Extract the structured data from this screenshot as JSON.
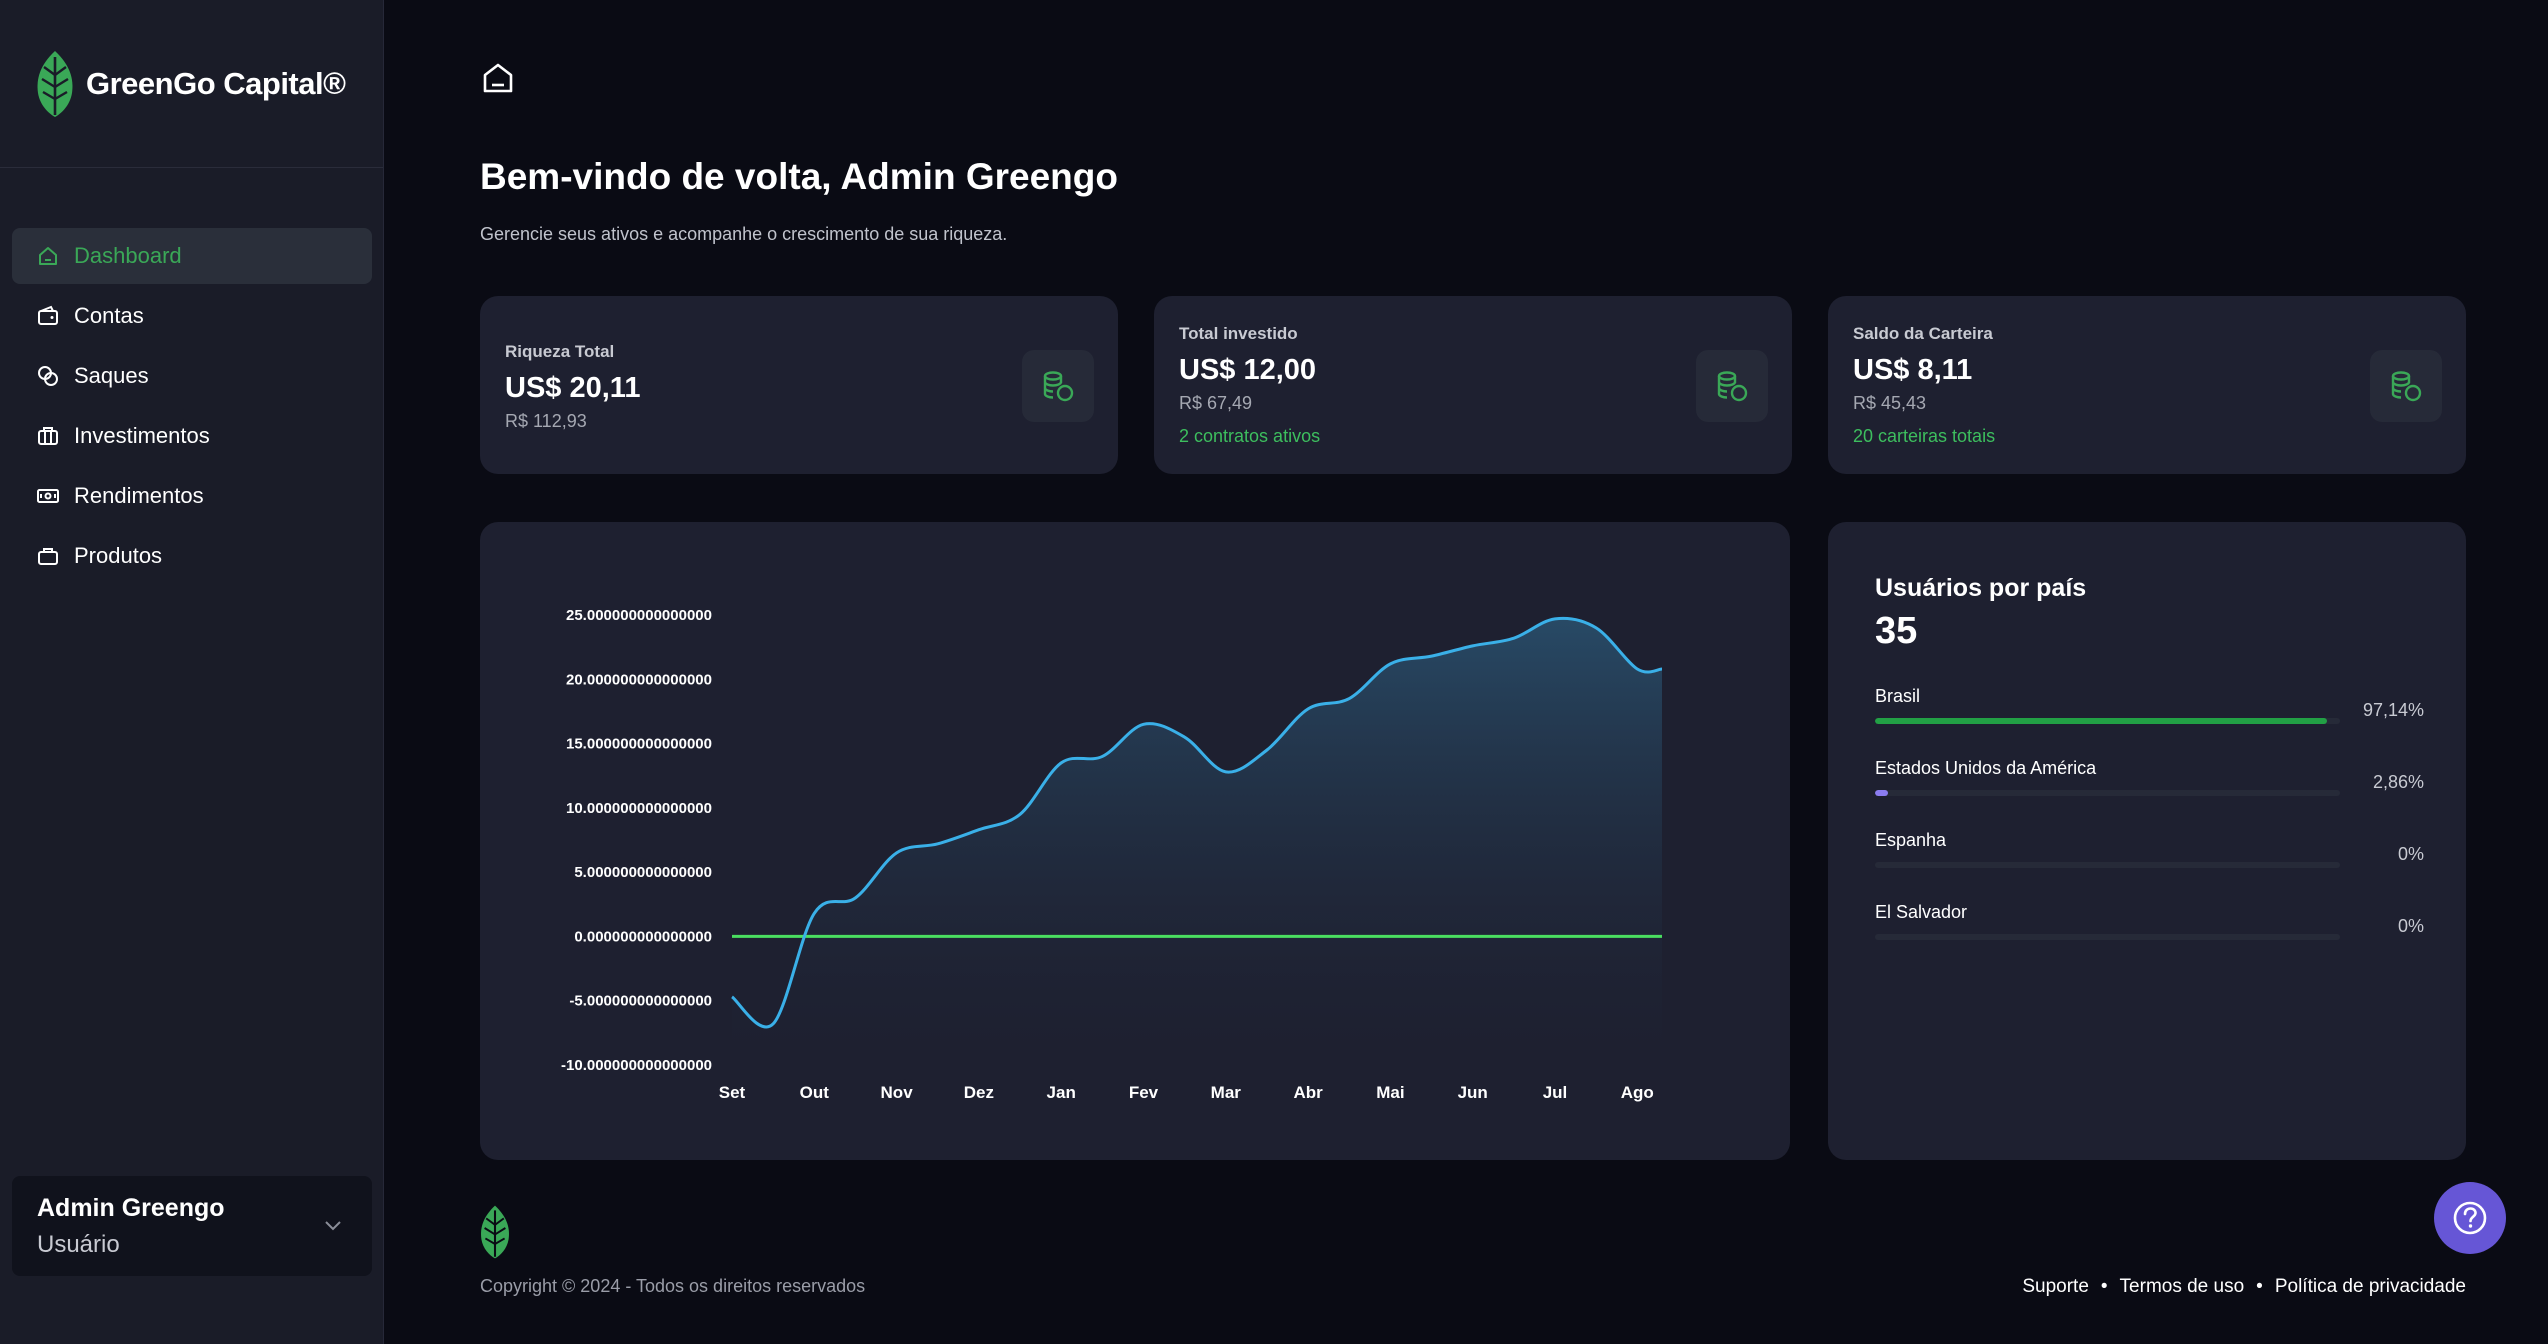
{
  "brand": {
    "name": "GreenGo Capital®"
  },
  "sidebar": {
    "items": [
      {
        "label": "Dashboard",
        "icon": "home-icon",
        "active": true
      },
      {
        "label": "Contas",
        "icon": "wallet-icon"
      },
      {
        "label": "Saques",
        "icon": "coins-icon"
      },
      {
        "label": "Investimentos",
        "icon": "briefcase-icon"
      },
      {
        "label": "Rendimentos",
        "icon": "banknote-icon"
      },
      {
        "label": "Produtos",
        "icon": "bag-icon"
      }
    ]
  },
  "user": {
    "name": "Admin Greengo",
    "role": "Usuário"
  },
  "header": {
    "welcome": "Bem-vindo de volta, Admin Greengo",
    "subtitle": "Gerencie seus ativos e acompanhe o crescimento de sua riqueza."
  },
  "cards": [
    {
      "label": "Riqueza Total",
      "value": "US$ 20,11",
      "sub": "R$ 112,93",
      "note": ""
    },
    {
      "label": "Total investido",
      "value": "US$ 12,00",
      "sub": "R$ 67,49",
      "note": "2 contratos ativos"
    },
    {
      "label": "Saldo da Carteira",
      "value": "US$ 8,11",
      "sub": "R$ 45,43",
      "note": "20 carteiras totais"
    }
  ],
  "chart_data": {
    "type": "area",
    "categories": [
      "Set",
      "Out",
      "Nov",
      "Dez",
      "Jan",
      "Fev",
      "Mar",
      "Abr",
      "Mai",
      "Jun",
      "Jul",
      "Ago"
    ],
    "y_tick_labels": [
      "25.000000000000000",
      "20.000000000000000",
      "15.000000000000000",
      "10.000000000000000",
      "5.000000000000000",
      "0.000000000000000",
      "-5.000000000000000",
      "-10.000000000000000"
    ],
    "y_ticks": [
      25,
      20,
      15,
      10,
      5,
      0,
      -5,
      -10
    ],
    "ylim": [
      -10,
      25
    ],
    "x": [
      0,
      0.5,
      1,
      1.5,
      2,
      2.5,
      3,
      3.5,
      4,
      4.5,
      5,
      5.5,
      6,
      6.5,
      7,
      7.5,
      8,
      8.5,
      9,
      9.5,
      10,
      10.5,
      11,
      11.3
    ],
    "values": [
      -4.7,
      -6.8,
      1.8,
      3.0,
      6.5,
      7.2,
      8.3,
      9.5,
      13.5,
      14.0,
      16.5,
      15.5,
      12.8,
      14.5,
      17.7,
      18.5,
      21.2,
      21.8,
      22.6,
      23.2,
      24.7,
      24.0,
      20.8,
      20.8
    ],
    "baseline": 0,
    "line_color": "#3ab0e8",
    "baseline_color": "#4ade60",
    "grid": false
  },
  "countries": {
    "title": "Usuários por país",
    "total": "35",
    "items": [
      {
        "name": "Brasil",
        "pct": "97,14%",
        "value": 97.14,
        "color": "#22a045"
      },
      {
        "name": "Estados Unidos da América",
        "pct": "2,86%",
        "value": 2.86,
        "color": "#8b7cf0"
      },
      {
        "name": "Espanha",
        "pct": "0%",
        "value": 0,
        "color": "#22a045"
      },
      {
        "name": "El Salvador",
        "pct": "0%",
        "value": 0,
        "color": "#22a045"
      }
    ]
  },
  "footer": {
    "copyright": "Copyright © 2024 - Todos os direitos reservados",
    "links": [
      "Suporte",
      "Termos de uso",
      "Política de privacidade"
    ]
  },
  "colors": {
    "accent": "#3aa857",
    "help": "#6656d6"
  }
}
